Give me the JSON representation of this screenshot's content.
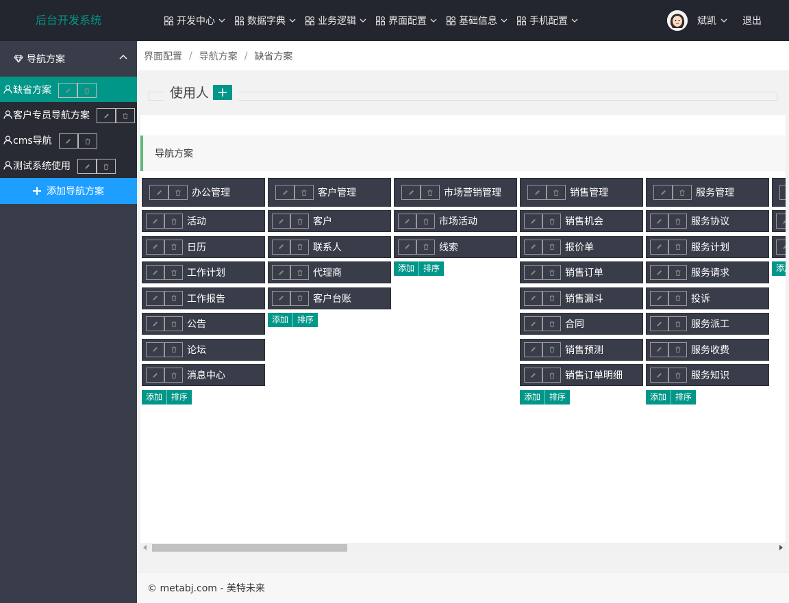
{
  "app": {
    "title": "后台开发系统"
  },
  "topnav": [
    {
      "label": "开发中心"
    },
    {
      "label": "数据字典"
    },
    {
      "label": "业务逻辑"
    },
    {
      "label": "界面配置"
    },
    {
      "label": "基础信息"
    },
    {
      "label": "手机配置"
    }
  ],
  "user": {
    "name": "斌凯",
    "logout": "退出"
  },
  "sidebar": {
    "title": "导航方案",
    "plans": [
      {
        "label": "缺省方案",
        "active": true
      },
      {
        "label": "客户专员导航方案",
        "active": false
      },
      {
        "label": "cms导航",
        "active": false
      },
      {
        "label": "测试系统使用",
        "active": false
      }
    ],
    "add_label": "添加导航方案"
  },
  "breadcrumb": [
    "界面配置",
    "导航方案",
    "缺省方案"
  ],
  "users_section": {
    "legend": "使用人",
    "add_symbol": "+"
  },
  "nav_section": {
    "title": "导航方案"
  },
  "actions": {
    "add": "添加",
    "sort": "排序"
  },
  "columns": [
    {
      "category": "办公管理",
      "items": [
        "活动",
        "日历",
        "工作计划",
        "工作报告",
        "公告",
        "论坛",
        "消息中心"
      ]
    },
    {
      "category": "客户管理",
      "items": [
        "客户",
        "联系人",
        "代理商",
        "客户台账"
      ]
    },
    {
      "category": "市场营销管理",
      "items": [
        "市场活动",
        "线索"
      ]
    },
    {
      "category": "销售管理",
      "items": [
        "销售机会",
        "报价单",
        "销售订单",
        "销售漏斗",
        "合同",
        "销售预测",
        "销售订单明细"
      ]
    },
    {
      "category": "服务管理",
      "items": [
        "服务协议",
        "服务计划",
        "服务请求",
        "投诉",
        "服务派工",
        "服务收费",
        "服务知识"
      ]
    },
    {
      "category": "",
      "items": [
        "",
        ""
      ]
    }
  ],
  "footer": {
    "text": "© metabj.com - 美特未来"
  },
  "colors": {
    "accent": "#009688",
    "header_bg": "#23262e",
    "side_bg": "#393d49",
    "blue": "#1e9fff"
  }
}
